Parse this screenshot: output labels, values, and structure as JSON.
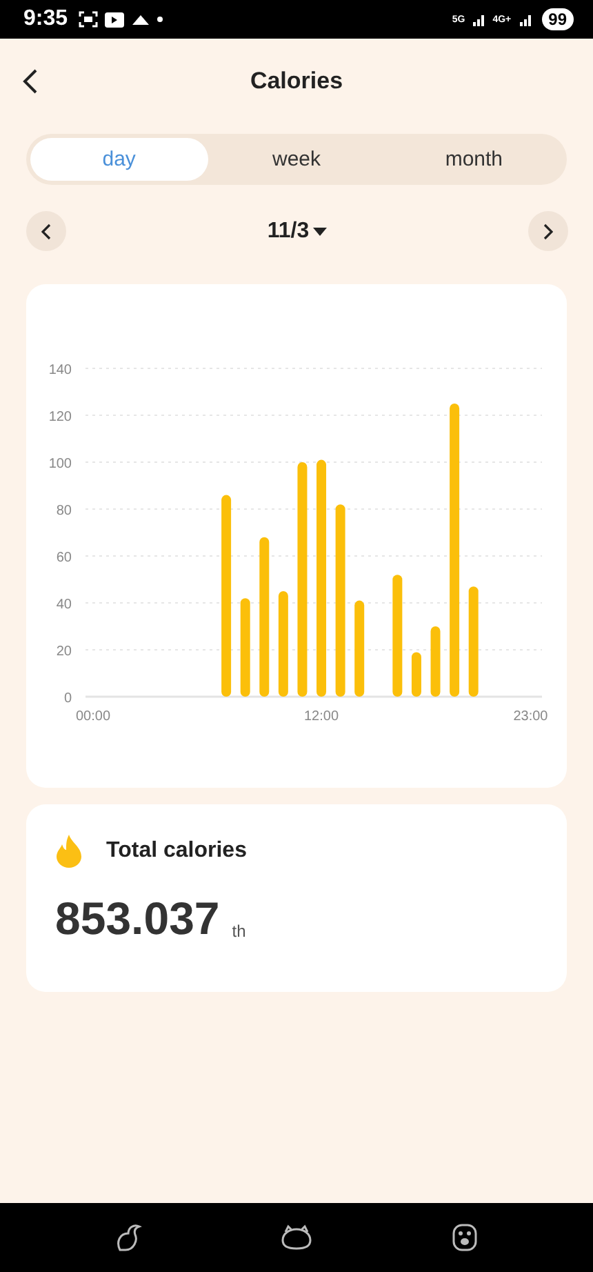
{
  "status_bar": {
    "time": "9:35",
    "network_1": "5G",
    "network_2": "4G+",
    "battery": "99"
  },
  "header": {
    "title": "Calories"
  },
  "tabs": [
    {
      "label": "day",
      "selected": true
    },
    {
      "label": "week",
      "selected": false
    },
    {
      "label": "month",
      "selected": false
    }
  ],
  "date_picker": {
    "label": "11/3"
  },
  "chart_data": {
    "type": "bar",
    "x": [
      0,
      1,
      2,
      3,
      4,
      5,
      6,
      7,
      8,
      9,
      10,
      11,
      12,
      13,
      14,
      15,
      16,
      17,
      18,
      19,
      20,
      21,
      22,
      23
    ],
    "values": [
      0,
      0,
      0,
      0,
      0,
      0,
      0,
      86,
      42,
      68,
      45,
      100,
      101,
      82,
      41,
      0,
      52,
      19,
      30,
      125,
      47,
      0,
      0,
      0
    ],
    "xlim": [
      -0.4,
      23.6
    ],
    "ylim": [
      0,
      140
    ],
    "grid": true,
    "yticks": [
      0,
      20,
      40,
      60,
      80,
      100,
      120,
      140
    ],
    "xticks": [
      {
        "value": 0,
        "label": "00:00"
      },
      {
        "value": 12,
        "label": "12:00"
      },
      {
        "value": 23,
        "label": "23:00"
      }
    ]
  },
  "summary": {
    "title": "Total calories",
    "value": "853.037",
    "unit": "th"
  }
}
